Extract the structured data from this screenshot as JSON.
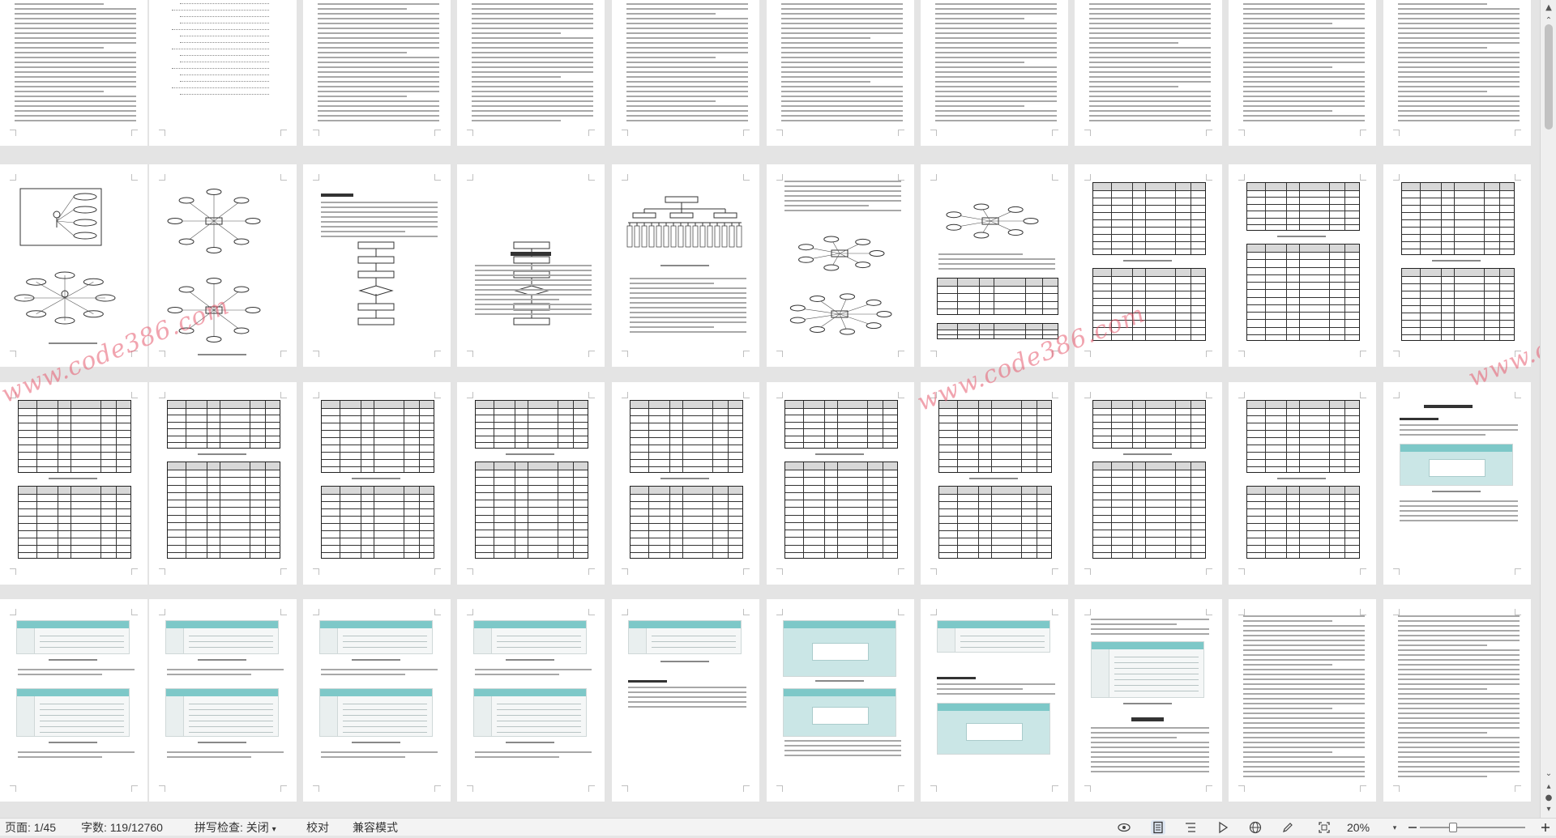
{
  "document": {
    "watermark": "www.code386.com",
    "toc_heading": "目录",
    "chapter_4_title": "4 数据库设计",
    "chapter_5_title": "5 系统实现",
    "chapter_6_title": "6 系统测试",
    "abstract_heading": "Abstract",
    "keywords_label": "关键词：Spring Boot；Vue；MySQL"
  },
  "statusbar": {
    "page": "页面: 1/45",
    "words": "字数: 119/12760",
    "spellcheck": "拼写检查: 关闭",
    "proofread": "校对",
    "compat_mode": "兼容模式",
    "zoom": "20%"
  },
  "icons": {
    "eye": "eye-icon",
    "page_view": "page-view-icon",
    "outline": "outline-icon",
    "play": "play-icon",
    "web": "web-layout-icon",
    "pen": "pen-icon",
    "fit": "fit-page-icon",
    "zoom_out": "zoom-out-icon",
    "zoom_in": "zoom-in-icon"
  }
}
